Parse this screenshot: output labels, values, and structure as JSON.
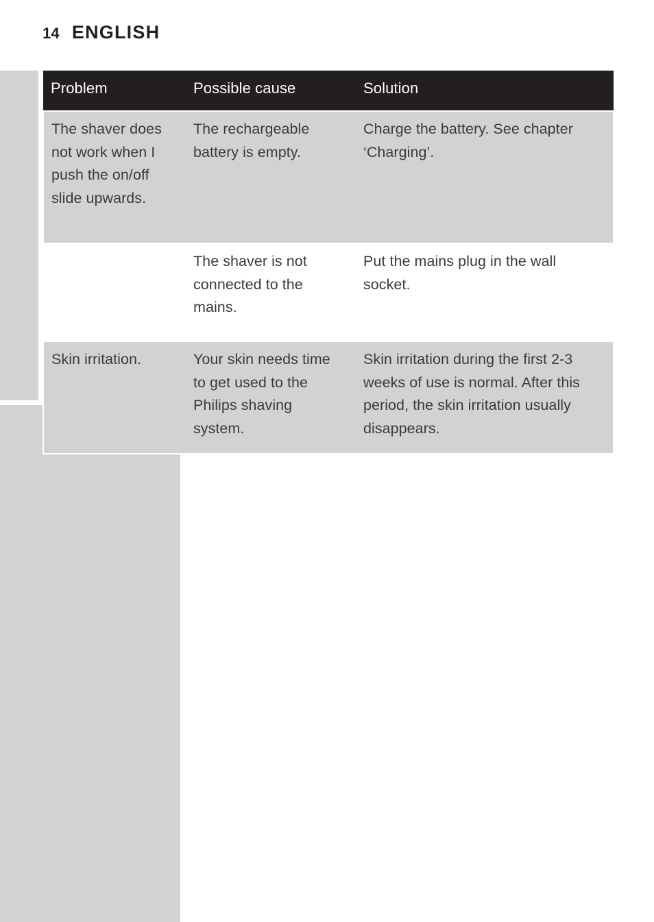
{
  "page": {
    "folio": "14",
    "chapter": "ENGLISH",
    "background_color": "#ffffff",
    "band_color": "#d2d2d2",
    "header_color": "#231f20",
    "text_color": "#3b3b3b"
  },
  "table": {
    "columns": [
      "Problem",
      "Possible cause",
      "Solution"
    ],
    "rows": [
      {
        "problem": "The shaver does not work when I push the on/off slide upwards.",
        "cause": "The rechargeable battery is empty.",
        "solution": "Charge the battery. See chapter ‘Charging’.",
        "shaded": true
      },
      {
        "problem": "",
        "cause": "The shaver is not connected to the mains.",
        "solution": "Put the mains plug in the wall socket.",
        "shaded": false
      },
      {
        "problem": "Skin irritation.",
        "cause": "Your skin needs time to get used to the Philips shaving system.",
        "solution": "Skin irritation during the first 2-3 weeks of use is normal. After this period, the skin irritation usually disappears.",
        "shaded": true
      }
    ]
  }
}
